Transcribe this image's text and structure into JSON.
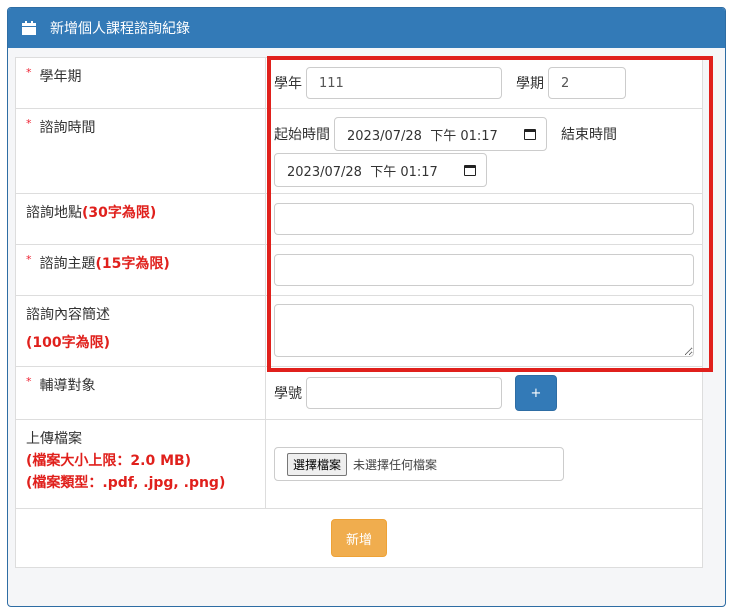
{
  "panel": {
    "title": "新增個人課程諮詢紀錄"
  },
  "form": {
    "term": {
      "label": "學年期",
      "year_label": "學年",
      "year_value": "111",
      "semester_label": "學期",
      "semester_value": "2"
    },
    "time": {
      "label": "諮詢時間",
      "start_label": "起始時間",
      "start_value": "2023/07/28  下午 01:17",
      "end_label": "結束時間",
      "end_value": "2023/07/28  下午 01:17"
    },
    "location": {
      "label": "諮詢地點",
      "limit": "(30字為限)",
      "value": ""
    },
    "topic": {
      "label": "諮詢主題",
      "limit": "(15字為限)",
      "value": ""
    },
    "description": {
      "label": "諮詢內容簡述",
      "limit": "(100字為限)",
      "value": ""
    },
    "target": {
      "label": "輔導對象",
      "id_label": "學號",
      "id_value": "",
      "add_button": "+"
    },
    "upload": {
      "label": "上傳檔案",
      "size_limit": "(檔案大小上限：2.0 MB)",
      "types": "(檔案類型：.pdf, .jpg, .png)",
      "choose_button": "選擇檔案",
      "no_file_text": "未選擇任何檔案"
    },
    "submit_label": "新增",
    "required_mark": "*"
  },
  "colors": {
    "primary": "#337ab7",
    "warning": "#f0ad4e",
    "highlight": "#e0201c"
  }
}
